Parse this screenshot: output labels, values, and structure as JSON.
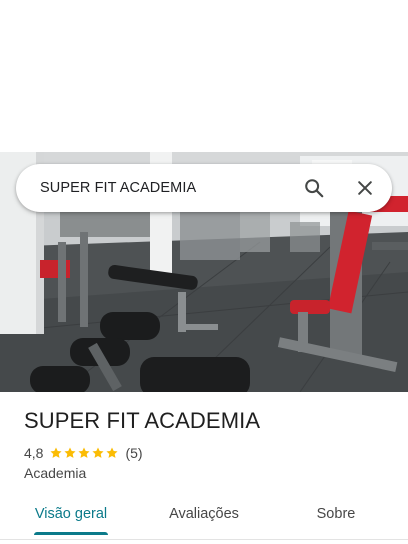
{
  "search": {
    "query": "SUPER FIT ACADEMIA",
    "search_icon": "search-icon",
    "close_icon": "close-icon"
  },
  "place": {
    "name": "SUPER FIT ACADEMIA",
    "rating": "4,8",
    "stars_filled": 5,
    "stars_total": 5,
    "review_count": "(5)",
    "category": "Academia"
  },
  "tabs": [
    {
      "label": "Visão geral",
      "active": true
    },
    {
      "label": "Avaliações",
      "active": false
    },
    {
      "label": "Sobre",
      "active": false
    }
  ],
  "colors": {
    "accent": "#0b7a8a",
    "star": "#fbbc04",
    "text_secondary": "#474747"
  }
}
